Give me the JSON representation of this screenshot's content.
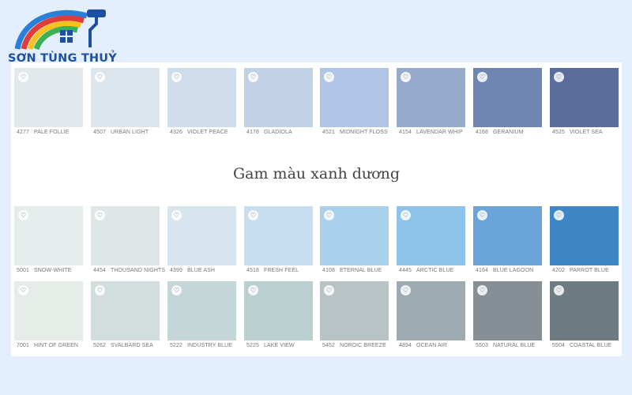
{
  "brand": {
    "name": "SƠN TÙNG THUỶ"
  },
  "section_heading": "Gam màu xanh dương",
  "rows": [
    [
      {
        "code": "4277",
        "name": "PALE FOLLIE",
        "color": "#e2e9ec"
      },
      {
        "code": "4507",
        "name": "URBAN LIGHT",
        "color": "#dce5ec"
      },
      {
        "code": "4326",
        "name": "VIOLET PEACE",
        "color": "#cfdcec"
      },
      {
        "code": "4178",
        "name": "GLADIOLA",
        "color": "#c2d2e6"
      },
      {
        "code": "4521",
        "name": "MIDNIGHT FLOSS",
        "color": "#b0c5e6"
      },
      {
        "code": "4154",
        "name": "LAVENDAR WHIP",
        "color": "#97abcc"
      },
      {
        "code": "4168",
        "name": "GERANIUM",
        "color": "#6f86b3"
      },
      {
        "code": "4525",
        "name": "VIOLET SEA",
        "color": "#5a6e9e"
      }
    ],
    [
      {
        "code": "5001",
        "name": "SNOW-WHITE",
        "color": "#e5ecec"
      },
      {
        "code": "4454",
        "name": "THOUSAND NIGHTS",
        "color": "#dfe6e7"
      },
      {
        "code": "4399",
        "name": "BLUE ASH",
        "color": "#d7e6ee"
      },
      {
        "code": "4518",
        "name": "FRESH FEEL",
        "color": "#c7ddf0"
      },
      {
        "code": "4108",
        "name": "ETERNAL BLUE",
        "color": "#a9d0ec"
      },
      {
        "code": "4445",
        "name": "ARCTIC BLUE",
        "color": "#8ec4ea"
      },
      {
        "code": "4164",
        "name": "BLUE LAGOON",
        "color": "#6ba4d9"
      },
      {
        "code": "4202",
        "name": "PARROT BLUE",
        "color": "#3f86c6"
      }
    ],
    [
      {
        "code": "7001",
        "name": "HINT OF GREEN",
        "color": "#e6ede8"
      },
      {
        "code": "5262",
        "name": "SVALBARD SEA",
        "color": "#d2dede"
      },
      {
        "code": "5222",
        "name": "INDUSTRY BLUE",
        "color": "#c5d6d9"
      },
      {
        "code": "5225",
        "name": "LAKE VIEW",
        "color": "#b9cfd0"
      },
      {
        "code": "5452",
        "name": "NORDIC BREEZE",
        "color": "#b8c3c6"
      },
      {
        "code": "4894",
        "name": "OCEAN AIR",
        "color": "#9eabb3"
      },
      {
        "code": "5503",
        "name": "NATURAL BLUE",
        "color": "#868f95"
      },
      {
        "code": "5504",
        "name": "COASTAL BLUE",
        "color": "#6e7b83"
      }
    ]
  ]
}
